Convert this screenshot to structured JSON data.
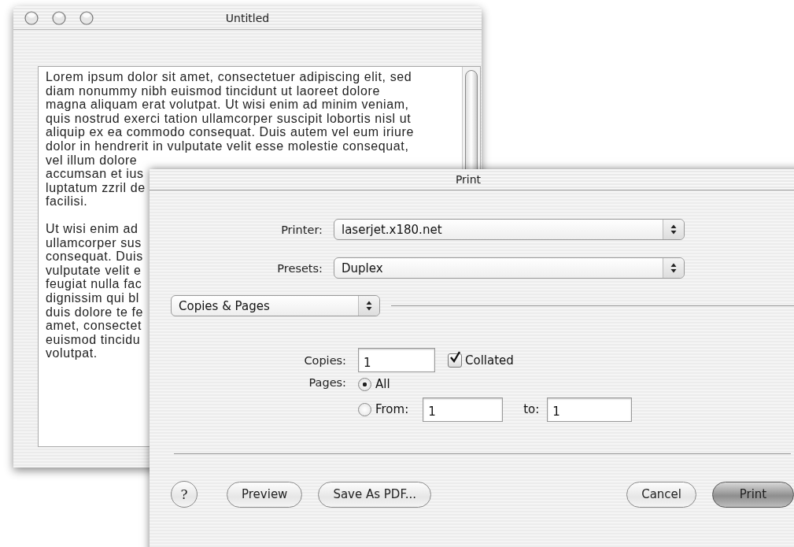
{
  "document_window": {
    "title": "Untitled",
    "paragraphs": [
      [
        "Lorem ipsum dolor sit amet, consectetuer adipiscing elit, sed",
        "diam nonummy nibh euismod tincidunt ut laoreet dolore",
        "magna aliquam erat volutpat. Ut wisi enim ad minim veniam,",
        "quis nostrud exerci tation ullamcorper suscipit lobortis nisl ut",
        "aliquip ex ea commodo consequat. Duis autem vel eum iriure",
        "dolor in hendrerit in vulputate velit esse molestie consequat,",
        "vel illum dolore",
        "accumsan et ius",
        "luptatum zzril de",
        "facilisi."
      ],
      [
        "Ut wisi enim ad",
        "ullamcorper sus",
        "consequat. Duis",
        "vulputate velit e",
        "feugiat nulla fac",
        "dignissim qui bl",
        "duis dolore te fe",
        "amet, consectet",
        "euismod tincidu",
        "volutpat."
      ]
    ]
  },
  "print_dialog": {
    "title": "Print",
    "printer": {
      "label": "Printer:",
      "value": "laserjet.x180.net"
    },
    "presets": {
      "label": "Presets:",
      "value": "Duplex"
    },
    "section": {
      "value": "Copies & Pages"
    },
    "copies": {
      "label": "Copies:",
      "value": "1"
    },
    "collated": {
      "label": "Collated",
      "checked": true
    },
    "pages": {
      "label": "Pages:",
      "options": [
        {
          "label": "All",
          "selected": true
        },
        {
          "label": "From:",
          "selected": false
        }
      ],
      "from": {
        "value": "1"
      },
      "to": {
        "label": "to:",
        "value": "1"
      }
    },
    "buttons": [
      {
        "label": "?",
        "kind": "help"
      },
      {
        "label": "Preview",
        "kind": "normal"
      },
      {
        "label": "Save As PDF...",
        "kind": "normal"
      },
      {
        "label": "Cancel",
        "kind": "normal"
      },
      {
        "label": "Print",
        "kind": "default"
      }
    ]
  }
}
